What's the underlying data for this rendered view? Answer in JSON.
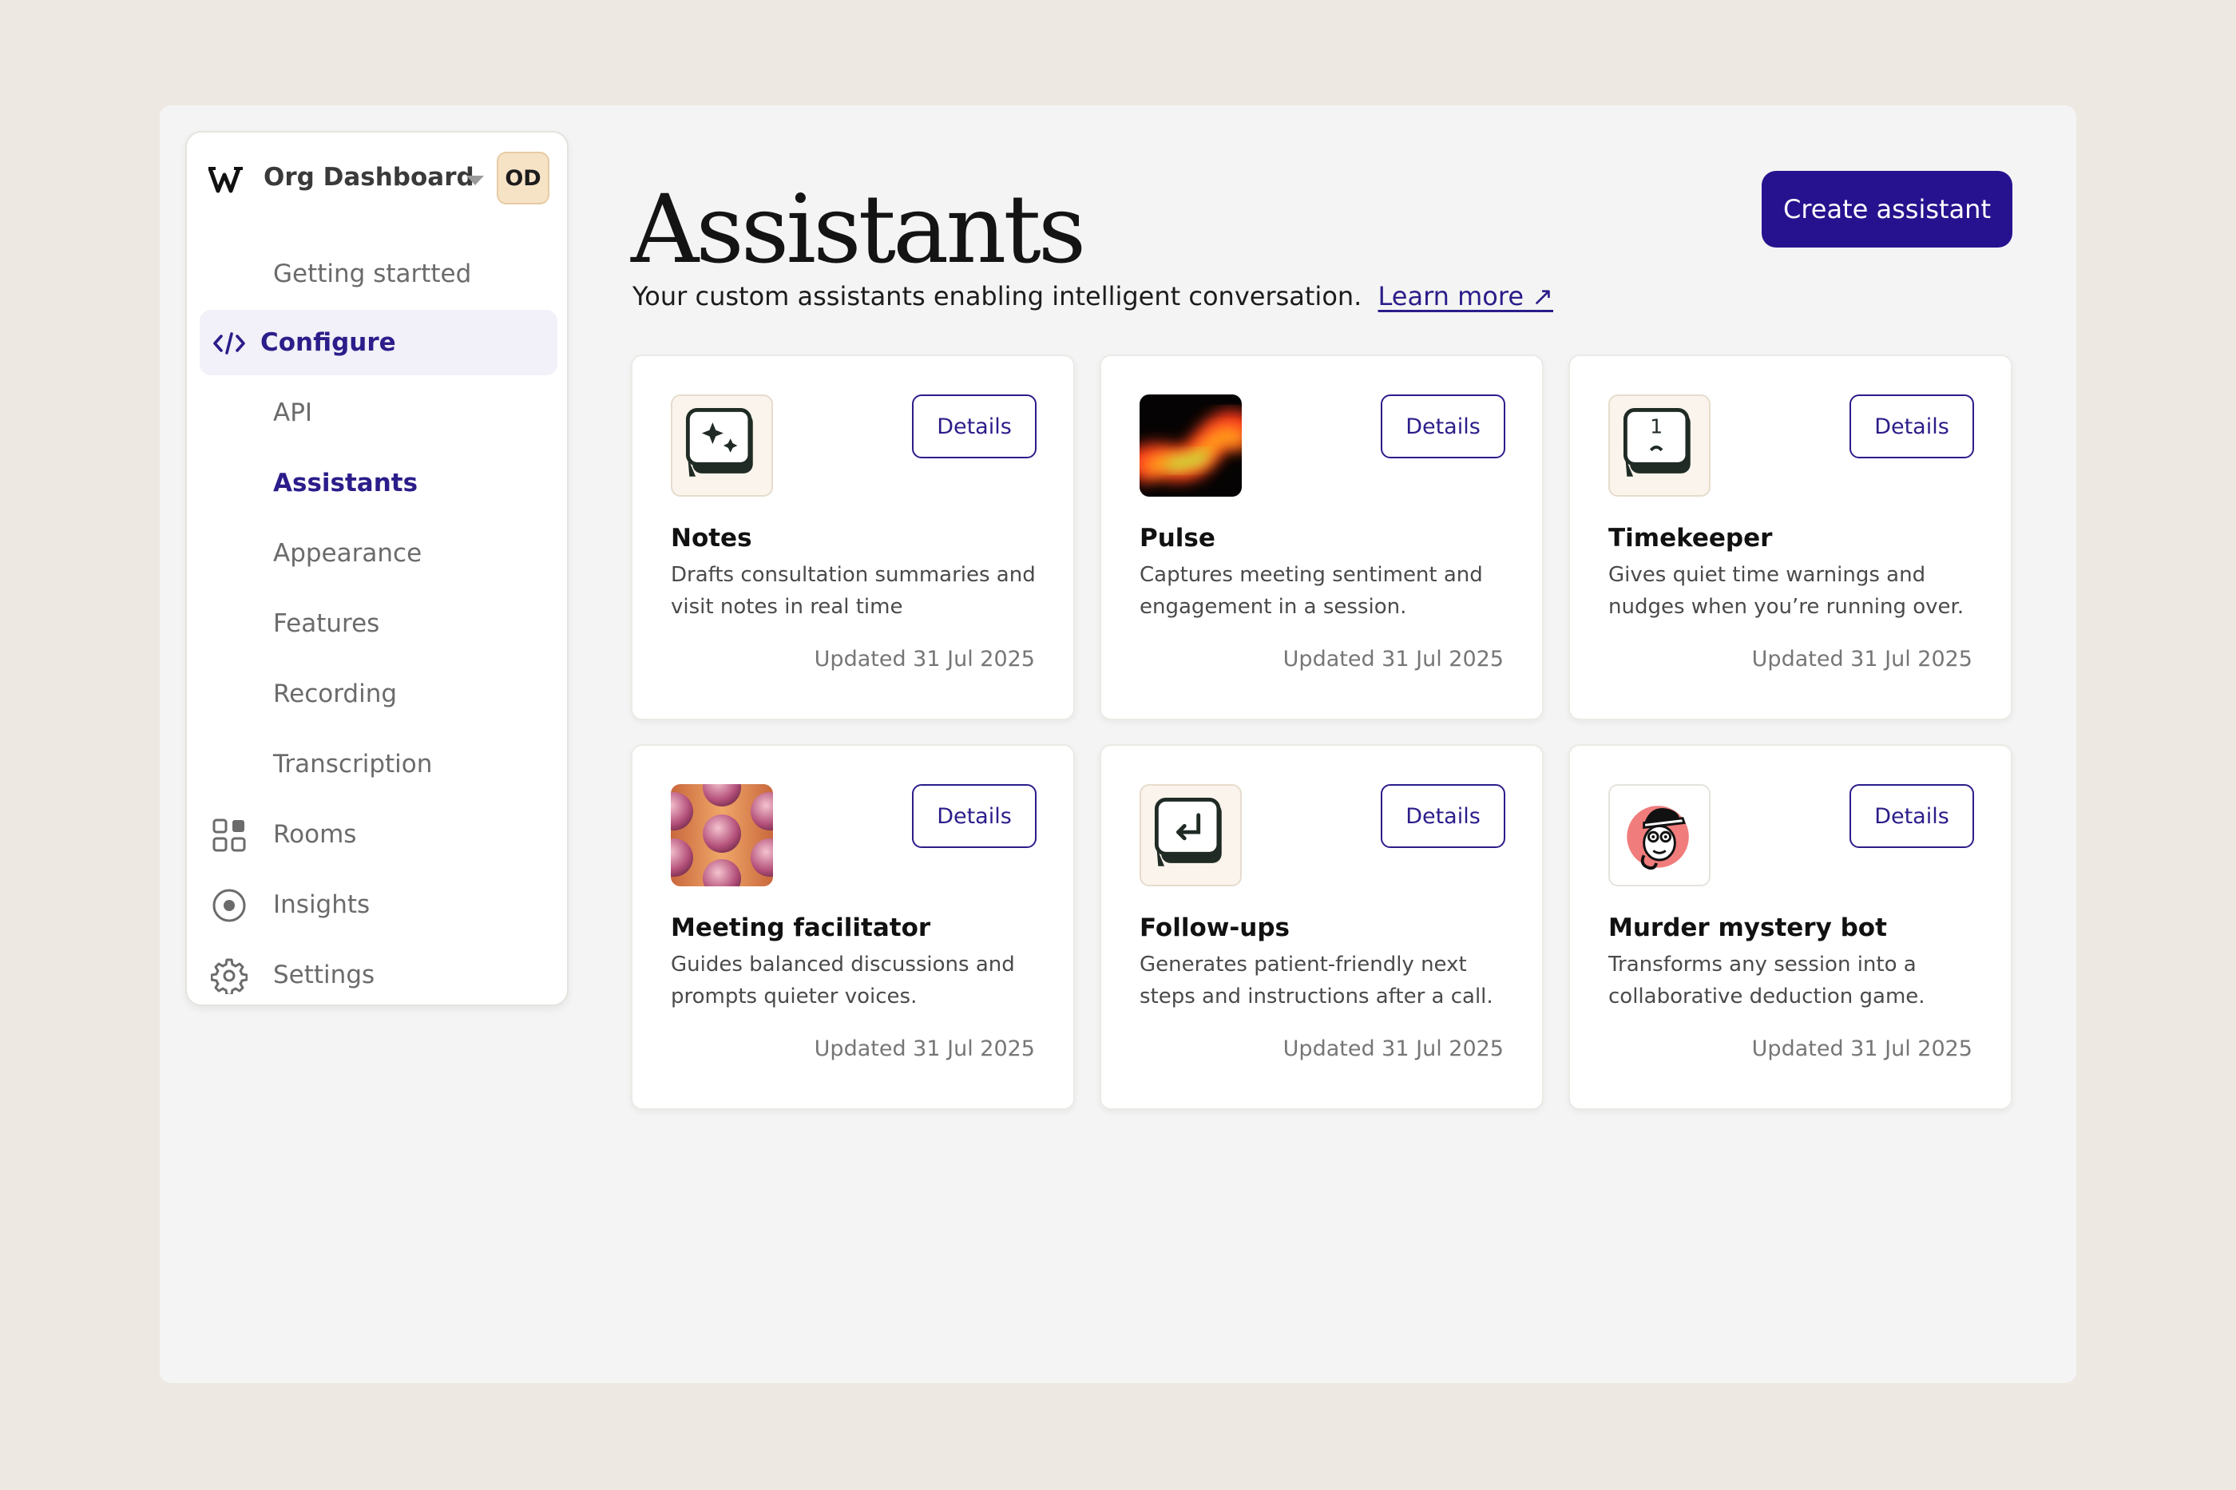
{
  "sidebar": {
    "org_name": "Org Dashboard",
    "avatar_initials": "OD",
    "items": [
      {
        "label": "Getting startted"
      },
      {
        "label": "Configure"
      },
      {
        "label": "API"
      },
      {
        "label": "Assistants"
      },
      {
        "label": "Appearance"
      },
      {
        "label": "Features"
      },
      {
        "label": "Recording"
      },
      {
        "label": "Transcription"
      },
      {
        "label": "Rooms"
      },
      {
        "label": "Insights"
      },
      {
        "label": "Settings"
      }
    ]
  },
  "header": {
    "title": "Assistants",
    "subtitle": "Your custom assistants enabling intelligent conversation.",
    "learn_more": "Learn more ↗",
    "create_button": "Create assistant"
  },
  "cards": [
    {
      "name": "Notes",
      "description": "Drafts consultation summaries and visit notes in real time",
      "updated": "Updated 31 Jul 2025",
      "details": "Details",
      "icon": "sparkle-key-icon"
    },
    {
      "name": "Pulse",
      "description": "Captures meeting sentiment and engagement in a session.",
      "updated": "Updated 31 Jul 2025",
      "details": "Details",
      "icon": "heat-wave-icon"
    },
    {
      "name": "Timekeeper",
      "description": "Gives quiet time warnings and nudges when you’re running over.",
      "updated": "Updated 31 Jul 2025",
      "details": "Details",
      "icon": "number-key-icon"
    },
    {
      "name": "Meeting facilitator",
      "description": "Guides balanced discussions and prompts quieter voices.",
      "updated": "Updated 31 Jul 2025",
      "details": "Details",
      "icon": "sphere-pattern-icon"
    },
    {
      "name": "Follow-ups",
      "description": "Generates patient-friendly next steps and instructions after a call.",
      "updated": "Updated 31 Jul 2025",
      "details": "Details",
      "icon": "return-key-icon"
    },
    {
      "name": "Murder mystery bot",
      "description": "Transforms any session into a collaborative deduction game.",
      "updated": "Updated 31 Jul 2025",
      "details": "Details",
      "icon": "detective-character-icon"
    }
  ],
  "colors": {
    "accent": "#26128E",
    "page_bg": "#EDE9E2",
    "panel_bg": "#F4F4F4"
  }
}
